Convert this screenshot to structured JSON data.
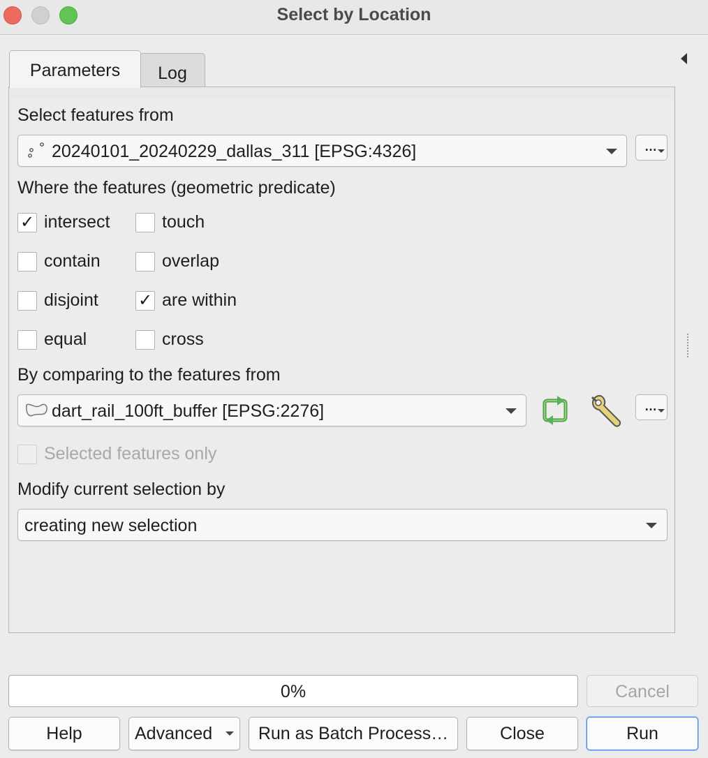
{
  "window": {
    "title": "Select by Location"
  },
  "tabs": [
    {
      "label": "Parameters",
      "active": true
    },
    {
      "label": "Log",
      "active": false
    }
  ],
  "select_from": {
    "label": "Select features from",
    "value": "20240101_20240229_dallas_311 [EPSG:4326]",
    "icon": "point-layer-icon"
  },
  "predicate": {
    "label": "Where the features (geometric predicate)",
    "options": [
      {
        "label": "intersect",
        "checked": true
      },
      {
        "label": "touch",
        "checked": false
      },
      {
        "label": "contain",
        "checked": false
      },
      {
        "label": "overlap",
        "checked": false
      },
      {
        "label": "disjoint",
        "checked": false
      },
      {
        "label": "are within",
        "checked": true
      },
      {
        "label": "equal",
        "checked": false
      },
      {
        "label": "cross",
        "checked": false
      }
    ]
  },
  "compare_to": {
    "label": "By comparing to the features from",
    "value": "dart_rail_100ft_buffer [EPSG:2276]",
    "icon": "polygon-layer-icon",
    "selected_only": {
      "label": "Selected features only",
      "checked": false,
      "enabled": false
    }
  },
  "modify": {
    "label": "Modify current selection by",
    "value": "creating new selection"
  },
  "misc": {
    "dots": "…"
  },
  "progress": {
    "text": "0%",
    "value": 0
  },
  "buttons": {
    "cancel": "Cancel",
    "help": "Help",
    "advanced": "Advanced",
    "batch": "Run as Batch Process…",
    "close": "Close",
    "run": "Run"
  },
  "colors": {
    "iterate_icon": "#5bb15b",
    "default_button_border": "#3b82f6"
  }
}
